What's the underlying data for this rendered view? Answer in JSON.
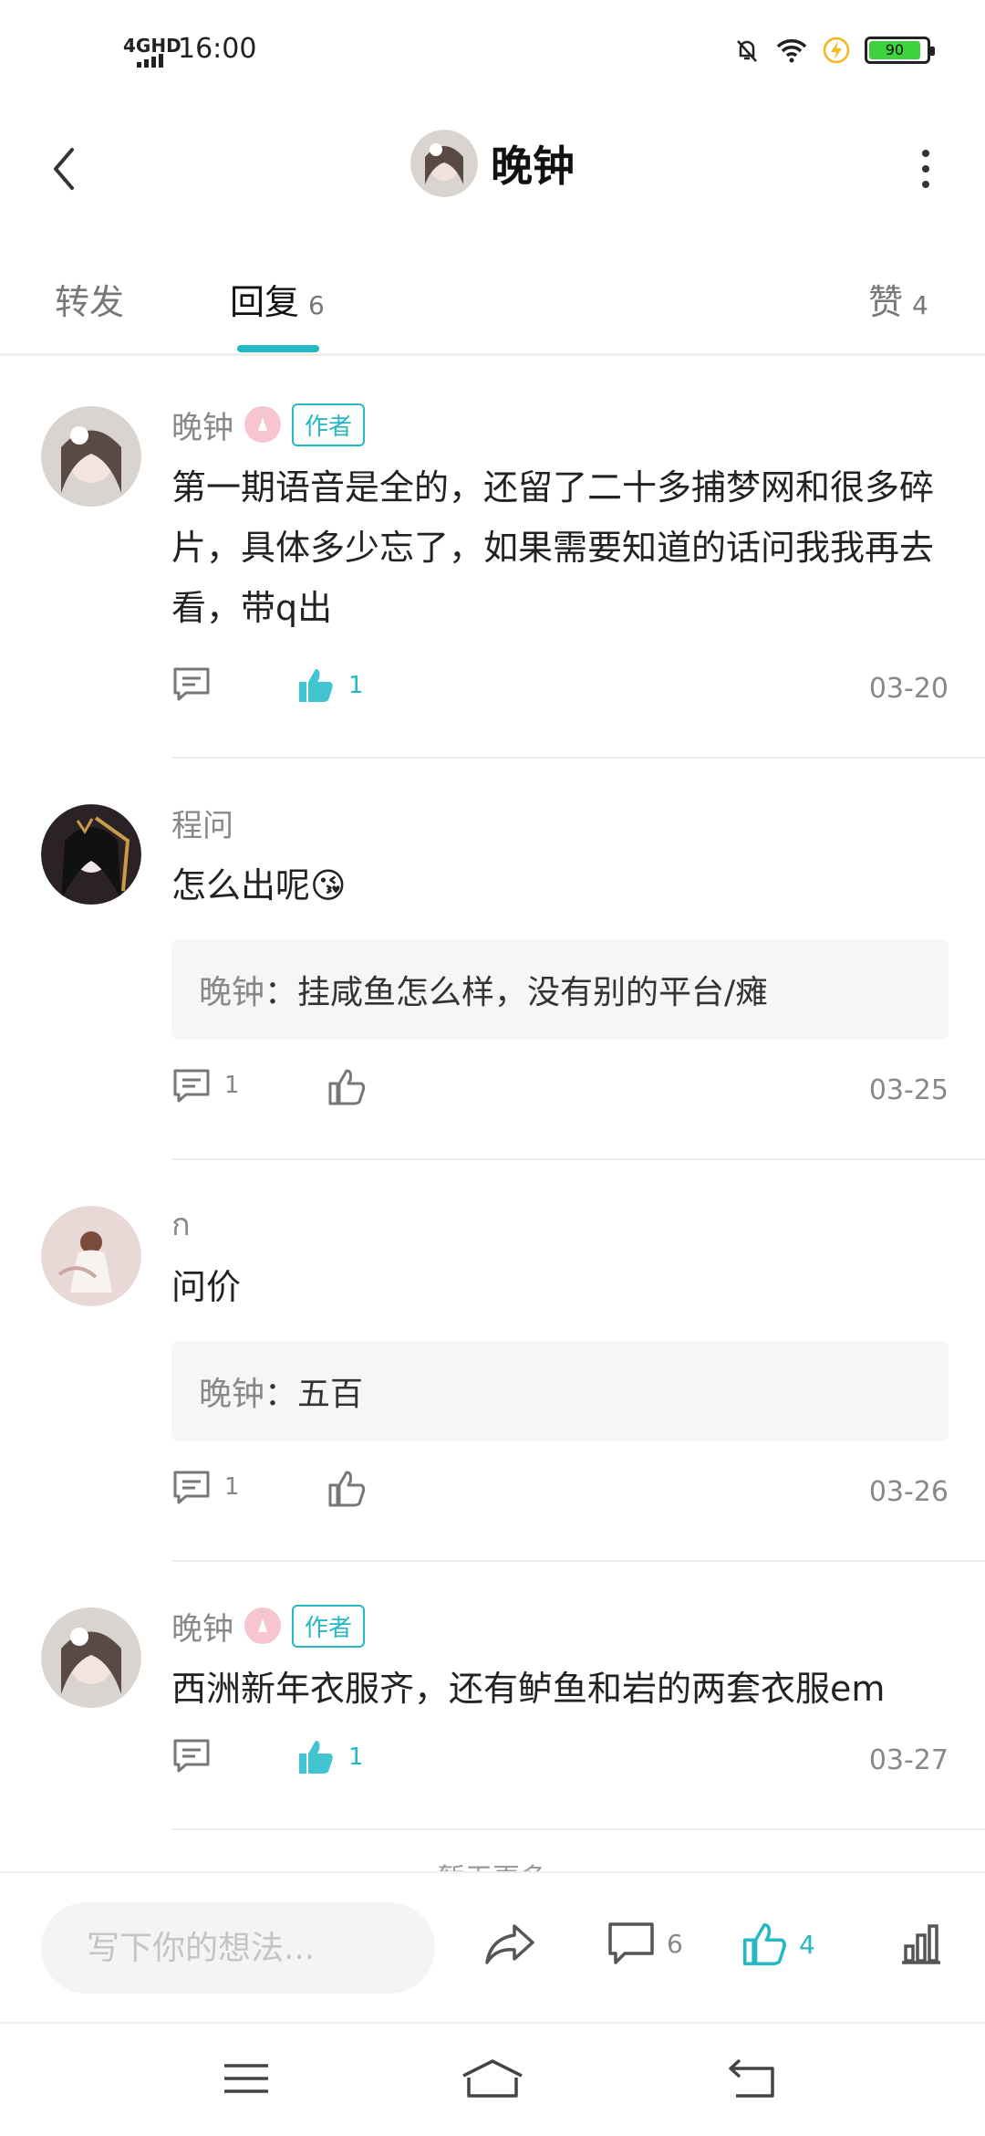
{
  "status_bar": {
    "network": "4GHD",
    "time": "16:00",
    "battery": "90",
    "icons": [
      "mute-bell-icon",
      "wifi-icon",
      "charging-icon",
      "battery-icon"
    ]
  },
  "header": {
    "title": "晚钟",
    "icons": [
      "back-icon",
      "more-icon"
    ]
  },
  "tabs": [
    {
      "label": "转发",
      "count": ""
    },
    {
      "label": "回复",
      "count": "6"
    },
    {
      "label": "赞",
      "count": "4"
    }
  ],
  "accent_color": "#25b8c4",
  "replies": [
    {
      "name": "晚钟",
      "author_tag": "作者",
      "text": "第一期语音是全的，还留了二十多捕梦网和很多碎片，具体多少忘了，如果需要知道的话问我我再去看，带q出",
      "quote_name": "",
      "quote_text": "",
      "reply_count": "",
      "like_count": "1",
      "liked": true,
      "date": "03-20"
    },
    {
      "name": "程问",
      "author_tag": "",
      "text": "怎么出呢😘",
      "quote_name": "晚钟",
      "quote_text": "挂咸鱼怎么样，没有别的平台/瘫",
      "reply_count": "1",
      "like_count": "",
      "liked": false,
      "date": "03-25"
    },
    {
      "name": "ก",
      "author_tag": "",
      "text": "问价",
      "quote_name": "晚钟",
      "quote_text": "五百",
      "reply_count": "1",
      "like_count": "",
      "liked": false,
      "date": "03-26"
    },
    {
      "name": "晚钟",
      "author_tag": "作者",
      "text": "西洲新年衣服齐，还有鲈鱼和岩的两套衣服em",
      "quote_name": "",
      "quote_text": "",
      "reply_count": "",
      "like_count": "1",
      "liked": true,
      "date": "03-27"
    }
  ],
  "no_more_text": "暂无更多",
  "bottom_bar": {
    "input_placeholder": "写下你的想法...",
    "comment_count": "6",
    "like_count": "4"
  },
  "nav_bar": {
    "icons": [
      "menu-icon",
      "home-icon",
      "back-nav-icon"
    ]
  }
}
